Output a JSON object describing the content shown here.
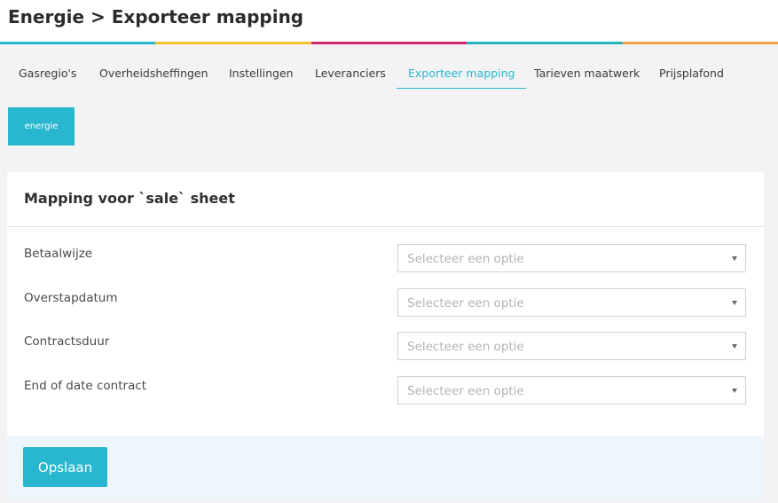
{
  "header": {
    "title": "Energie > Exporteer mapping",
    "stripe_colors": [
      "#29b6cf",
      "#f4c22b",
      "#d6266f",
      "#2ab3b8",
      "#f0a14a"
    ]
  },
  "tabs": [
    {
      "label": "Gasregio's",
      "active": false
    },
    {
      "label": "Overheidsheffingen",
      "active": false
    },
    {
      "label": "Instellingen",
      "active": false
    },
    {
      "label": "Leveranciers",
      "active": false
    },
    {
      "label": "Exporteer mapping",
      "active": true
    },
    {
      "label": "Tarieven maatwerk",
      "active": false
    },
    {
      "label": "Prijsplafond",
      "active": false
    }
  ],
  "chip": {
    "label": "energie"
  },
  "card": {
    "title": "Mapping voor `sale` sheet",
    "rows": [
      {
        "label": "Betaalwijze",
        "placeholder": "Selecteer een optie"
      },
      {
        "label": "Overstapdatum",
        "placeholder": "Selecteer een optie"
      },
      {
        "label": "Contractsduur",
        "placeholder": "Selecteer een optie"
      },
      {
        "label": "End of date contract",
        "placeholder": "Selecteer een optie"
      }
    ],
    "save_label": "Opslaan"
  },
  "colors": {
    "accent": "#29b6cf",
    "footer_bg": "#eef6fb",
    "page_bg": "#f3f3f5"
  }
}
